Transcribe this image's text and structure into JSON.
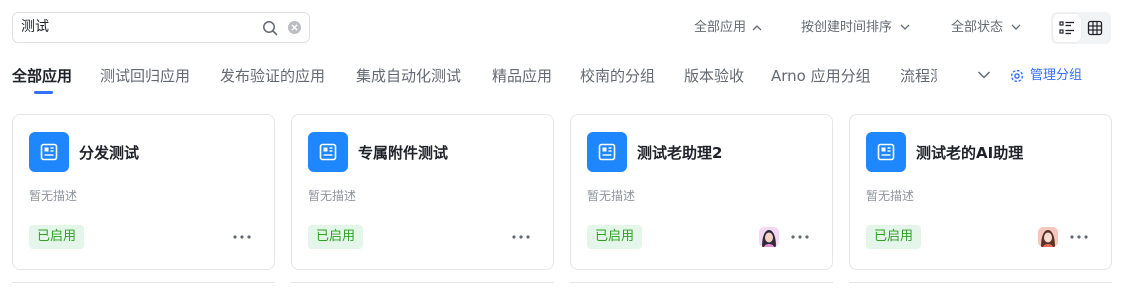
{
  "search": {
    "value": "测试",
    "icon": "search-icon",
    "clear_icon": "clear-icon"
  },
  "filters": [
    {
      "label": "全部应用",
      "icon": "chevron-up-icon"
    },
    {
      "label": "按创建时间排序",
      "icon": "chevron-down-icon"
    },
    {
      "label": "全部状态",
      "icon": "chevron-down-icon"
    }
  ],
  "view_toggle": {
    "list_icon": "list-view-icon",
    "grid_icon": "grid-view-icon",
    "active": "list"
  },
  "tabs": [
    {
      "label": "全部应用",
      "active": true
    },
    {
      "label": "测试回归应用"
    },
    {
      "label": "发布验证的应用"
    },
    {
      "label": "集成自动化测试"
    },
    {
      "label": "精品应用"
    },
    {
      "label": "校南的分组"
    },
    {
      "label": "版本验收"
    },
    {
      "label": "Arno 应用分组"
    },
    {
      "label": "流程测"
    }
  ],
  "tabs_more_icon": "chevron-down-icon",
  "manage_groups": {
    "label": "管理分组",
    "icon": "gear-icon"
  },
  "cards": [
    {
      "title": "分发测试",
      "desc": "暂无描述",
      "status": "已启用",
      "icon": "app-document-icon",
      "avatar": false
    },
    {
      "title": "专属附件测试",
      "desc": "暂无描述",
      "status": "已启用",
      "icon": "app-document-icon",
      "avatar": false
    },
    {
      "title": "测试老助理2",
      "desc": "暂无描述",
      "status": "已启用",
      "icon": "app-document-icon",
      "avatar": true
    },
    {
      "title": "测试老的AI助理",
      "desc": "暂无描述",
      "status": "已启用",
      "icon": "app-document-icon",
      "avatar": true
    }
  ],
  "colors": {
    "accent": "#3370ff",
    "app_icon_bg": "#1e87fd",
    "status_bg": "#e4f6ea",
    "status_text": "#2ea121",
    "muted_text": "#8f959e"
  }
}
